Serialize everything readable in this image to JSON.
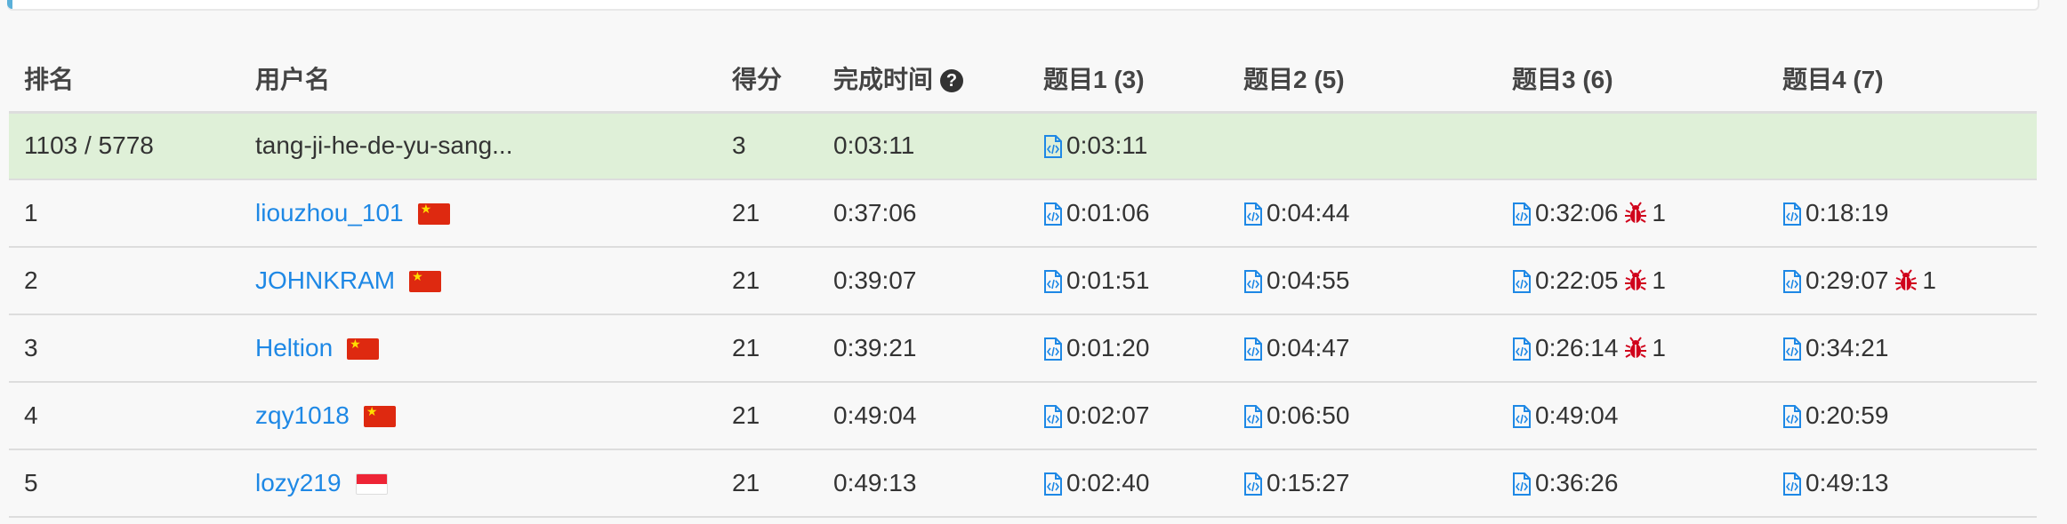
{
  "colors": {
    "link": "#1e88e5",
    "highlight_row": "#dff0d8",
    "bug": "#d0021b"
  },
  "headers": {
    "rank": "排名",
    "username": "用户名",
    "score": "得分",
    "finish_time": "完成时间",
    "q1": "题目1 (3)",
    "q2": "题目2 (5)",
    "q3": "题目3 (6)",
    "q4": "题目4 (7)"
  },
  "icons": {
    "help": "question-circle-icon",
    "submission": "code-file-icon",
    "wrong": "bug-icon",
    "flag_cn": "china-flag-icon",
    "flag_sg": "singapore-flag-icon"
  },
  "my_row": {
    "rank": "1103 / 5778",
    "username": "tang-ji-he-de-yu-sang...",
    "score": "3",
    "finish_time": "0:03:11",
    "q1": {
      "time": "0:03:11",
      "bugs": ""
    }
  },
  "rows": [
    {
      "rank": "1",
      "username": "liouzhou_101",
      "country": "cn",
      "score": "21",
      "finish_time": "0:37:06",
      "q1": {
        "time": "0:01:06",
        "bugs": ""
      },
      "q2": {
        "time": "0:04:44",
        "bugs": ""
      },
      "q3": {
        "time": "0:32:06",
        "bugs": "1"
      },
      "q4": {
        "time": "0:18:19",
        "bugs": ""
      }
    },
    {
      "rank": "2",
      "username": "JOHNKRAM",
      "country": "cn",
      "score": "21",
      "finish_time": "0:39:07",
      "q1": {
        "time": "0:01:51",
        "bugs": ""
      },
      "q2": {
        "time": "0:04:55",
        "bugs": ""
      },
      "q3": {
        "time": "0:22:05",
        "bugs": "1"
      },
      "q4": {
        "time": "0:29:07",
        "bugs": "1"
      }
    },
    {
      "rank": "3",
      "username": "Heltion",
      "country": "cn",
      "score": "21",
      "finish_time": "0:39:21",
      "q1": {
        "time": "0:01:20",
        "bugs": ""
      },
      "q2": {
        "time": "0:04:47",
        "bugs": ""
      },
      "q3": {
        "time": "0:26:14",
        "bugs": "1"
      },
      "q4": {
        "time": "0:34:21",
        "bugs": ""
      }
    },
    {
      "rank": "4",
      "username": "zqy1018",
      "country": "cn",
      "score": "21",
      "finish_time": "0:49:04",
      "q1": {
        "time": "0:02:07",
        "bugs": ""
      },
      "q2": {
        "time": "0:06:50",
        "bugs": ""
      },
      "q3": {
        "time": "0:49:04",
        "bugs": ""
      },
      "q4": {
        "time": "0:20:59",
        "bugs": ""
      }
    },
    {
      "rank": "5",
      "username": "lozy219",
      "country": "sg",
      "score": "21",
      "finish_time": "0:49:13",
      "q1": {
        "time": "0:02:40",
        "bugs": ""
      },
      "q2": {
        "time": "0:15:27",
        "bugs": ""
      },
      "q3": {
        "time": "0:36:26",
        "bugs": ""
      },
      "q4": {
        "time": "0:49:13",
        "bugs": ""
      }
    }
  ]
}
